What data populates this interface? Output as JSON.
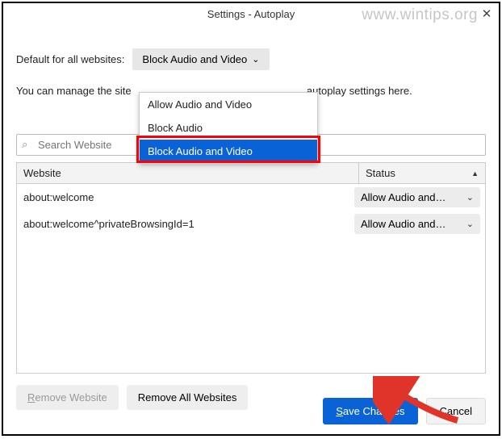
{
  "window": {
    "title": "Settings - Autoplay",
    "watermark": "www.wintips.org"
  },
  "labels": {
    "default_for_all": "Default for all websites:",
    "manage_prefix": "You can manage the site",
    "manage_suffix": " autoplay settings here.",
    "search_placeholder": "Search Website"
  },
  "dropdown": {
    "selected": "Block Audio and Video",
    "options": [
      "Allow Audio and Video",
      "Block Audio",
      "Block Audio and Video"
    ]
  },
  "table": {
    "col_website": "Website",
    "col_status": "Status",
    "rows": [
      {
        "website": "about:welcome",
        "status": "Allow Audio and…"
      },
      {
        "website": "about:welcome^privateBrowsingId=1",
        "status": "Allow Audio and…"
      }
    ]
  },
  "buttons": {
    "remove_website": "Remove Website",
    "remove_all": "Remove All Websites",
    "save": "Save Changes",
    "cancel": "Cancel"
  }
}
